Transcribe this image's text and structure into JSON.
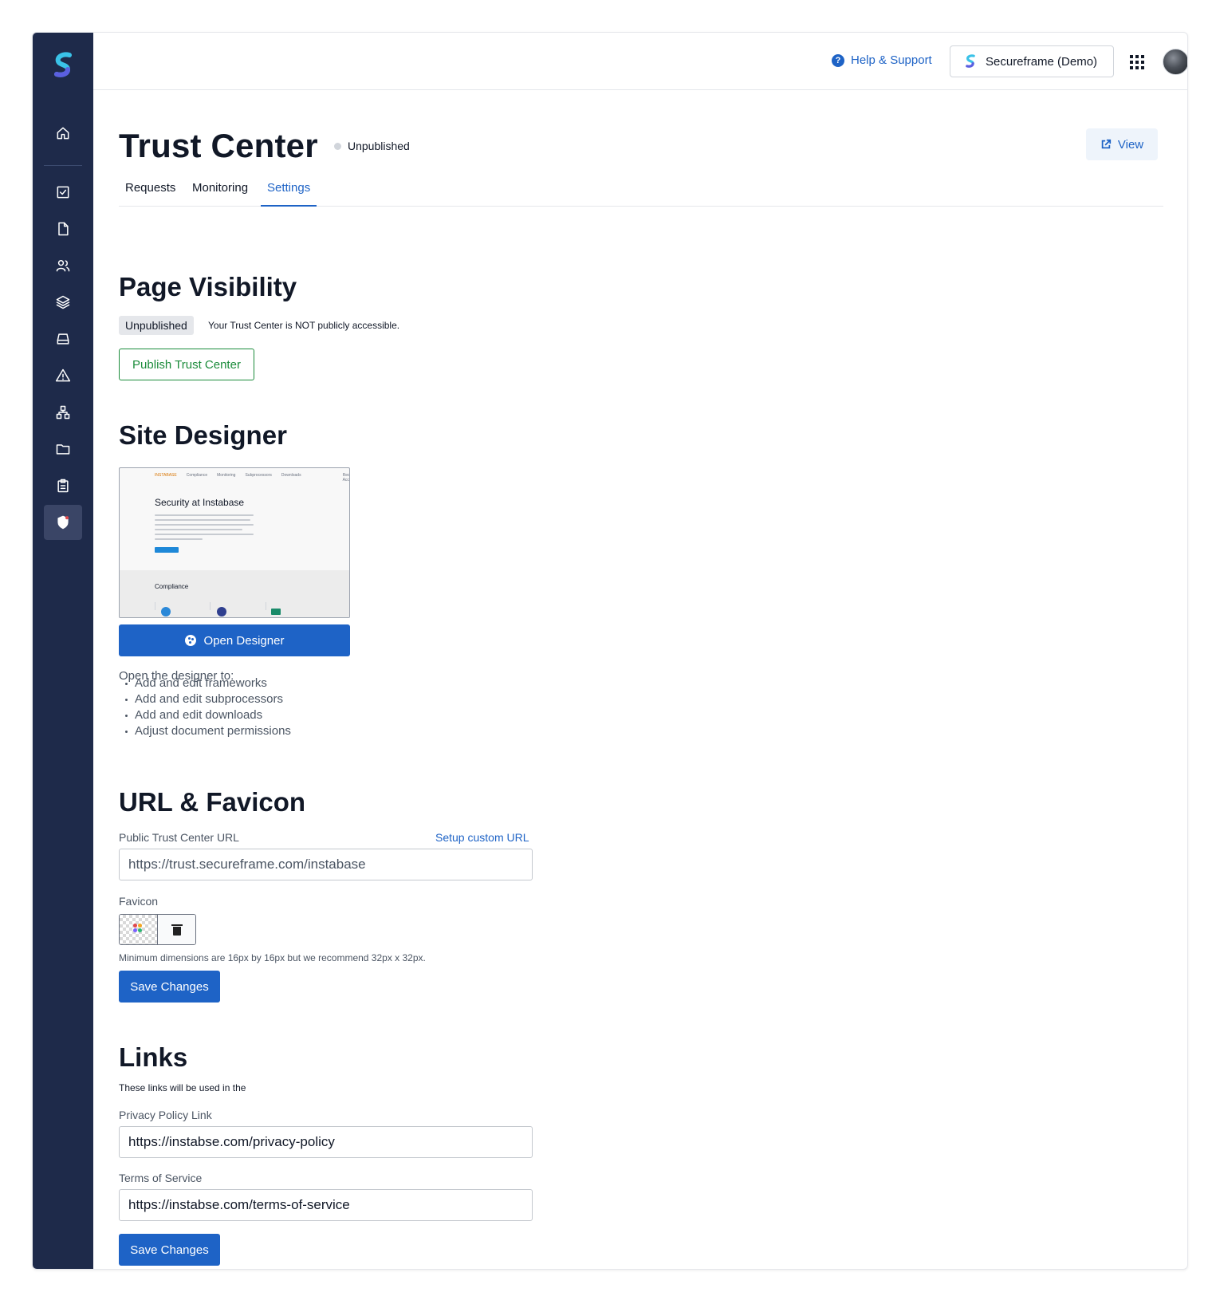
{
  "topbar": {
    "help_label": "Help & Support",
    "org_name": "Secureframe (Demo)"
  },
  "sidebar": {
    "items": [
      {
        "name": "home-icon"
      },
      {
        "name": "checkbox-icon"
      },
      {
        "name": "document-icon"
      },
      {
        "name": "users-icon"
      },
      {
        "name": "layers-icon"
      },
      {
        "name": "inbox-icon"
      },
      {
        "name": "warning-icon"
      },
      {
        "name": "hierarchy-icon"
      },
      {
        "name": "folder-icon"
      },
      {
        "name": "clipboard-icon"
      },
      {
        "name": "shield-icon",
        "active": true
      }
    ]
  },
  "header": {
    "title": "Trust Center",
    "status": "Unpublished",
    "view_label": "View"
  },
  "tabs": [
    {
      "label": "Requests",
      "active": false
    },
    {
      "label": "Monitoring",
      "active": false
    },
    {
      "label": "Settings",
      "active": true
    }
  ],
  "visibility": {
    "heading": "Page Visibility",
    "badge": "Unpublished",
    "note": "Your Trust Center is NOT publicly accessible.",
    "publish_label": "Publish Trust Center"
  },
  "designer": {
    "heading": "Site Designer",
    "preview": {
      "brand": "INSTABASE",
      "nav": [
        "Compliance",
        "Monitoring",
        "Subprocessors",
        "Downloads"
      ],
      "request": "Request Access",
      "title": "Security at Instabase",
      "compliance": "Compliance"
    },
    "open_label": "Open Designer",
    "intro": "Open the designer to:",
    "bullets": [
      "Add and edit frameworks",
      "Add and edit subprocessors",
      "Add and edit downloads",
      "Adjust document permissions"
    ]
  },
  "url_favicon": {
    "heading": "URL & Favicon",
    "url_label": "Public Trust Center URL",
    "setup_link": "Setup custom URL",
    "url_value": "https://trust.secureframe.com/instabase",
    "favicon_label": "Favicon",
    "favicon_hint": "Minimum dimensions are 16px by 16px but we recommend 32px x 32px.",
    "save_label": "Save Changes"
  },
  "links": {
    "heading": "Links",
    "subtitle": "These links will be used in the",
    "privacy_label": "Privacy Policy Link",
    "privacy_value": "https://instabse.com/privacy-policy",
    "terms_label": "Terms of Service",
    "terms_value": "https://instabse.com/terms-of-service",
    "save_label": "Save Changes"
  },
  "colors": {
    "sidebar": "#1e2a4a",
    "accent": "#1e63c6",
    "publish_green": "#1a8b3a"
  }
}
